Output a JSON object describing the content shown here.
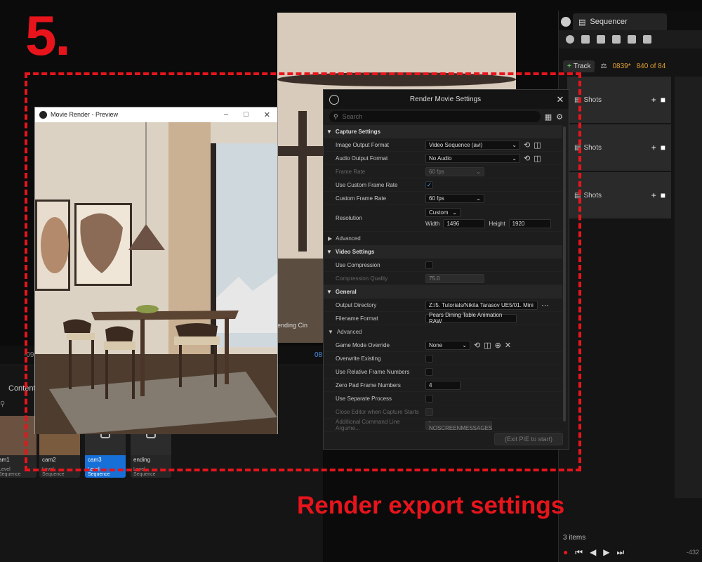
{
  "step": "5.",
  "caption": "Render export settings",
  "content_browser": {
    "time_left": "-09",
    "time_mid": "08",
    "tab_label": "Content",
    "thumbnails": [
      {
        "label": "am1",
        "type": "Level Sequence"
      },
      {
        "label": "cam2",
        "type": "Level Sequence"
      },
      {
        "label": "cam3",
        "type": "Level Sequence"
      },
      {
        "label": "ending",
        "type": "Level Sequence"
      }
    ]
  },
  "background_overlay_text": "ending Cin",
  "sequencer": {
    "tab": "Sequencer",
    "track_button": "Track",
    "current_frame": "0839*",
    "frame_range": "840 of 84",
    "rows": [
      "Shots",
      "Shots",
      "Shots"
    ],
    "items_count": "3 items",
    "end_time": "-432"
  },
  "preview": {
    "title": "Movie Render - Preview"
  },
  "settings": {
    "title": "Render Movie Settings",
    "search_placeholder": "Search",
    "capture_section": "Capture Settings",
    "image_output_format_label": "Image Output Format",
    "image_output_format_value": "Video Sequence (avi)",
    "audio_output_format_label": "Audio Output Format",
    "audio_output_format_value": "No Audio",
    "frame_rate_label": "Frame Rate",
    "frame_rate_value": "60 fps",
    "use_custom_frame_rate_label": "Use Custom Frame Rate",
    "custom_frame_rate_label": "Custom Frame Rate",
    "custom_frame_rate_value": "60 fps",
    "resolution_label": "Resolution",
    "resolution_preset": "Custom",
    "width_label": "Width",
    "width_value": "1496",
    "height_label": "Height",
    "height_value": "1920",
    "advanced_label": "Advanced",
    "video_section": "Video Settings",
    "use_compression_label": "Use Compression",
    "compression_quality_label": "Compression Quality",
    "compression_quality_value": "75.0",
    "general_section": "General",
    "output_directory_label": "Output Directory",
    "output_directory_value": "Z:/5. Tutorials/Nikita Tarasov UE5/01. Mini",
    "filename_format_label": "Filename Format",
    "filename_format_value": "Pears Dining Table Animation RAW",
    "advanced2_label": "Advanced",
    "game_mode_override_label": "Game Mode Override",
    "game_mode_override_value": "None",
    "overwrite_existing_label": "Overwrite Existing",
    "use_relative_frame_numbers_label": "Use Relative Frame Numbers",
    "zero_pad_label": "Zero Pad Frame Numbers",
    "zero_pad_value": "4",
    "use_separate_process_label": "Use Separate Process",
    "close_editor_label": "Close Editor when Capture Starts",
    "additional_cmd_label": "Additional Command Line Argume...",
    "additional_cmd_value": "-NOSCREENMESSAGES",
    "exit_pie_button": "(Exit PIE to start)"
  }
}
